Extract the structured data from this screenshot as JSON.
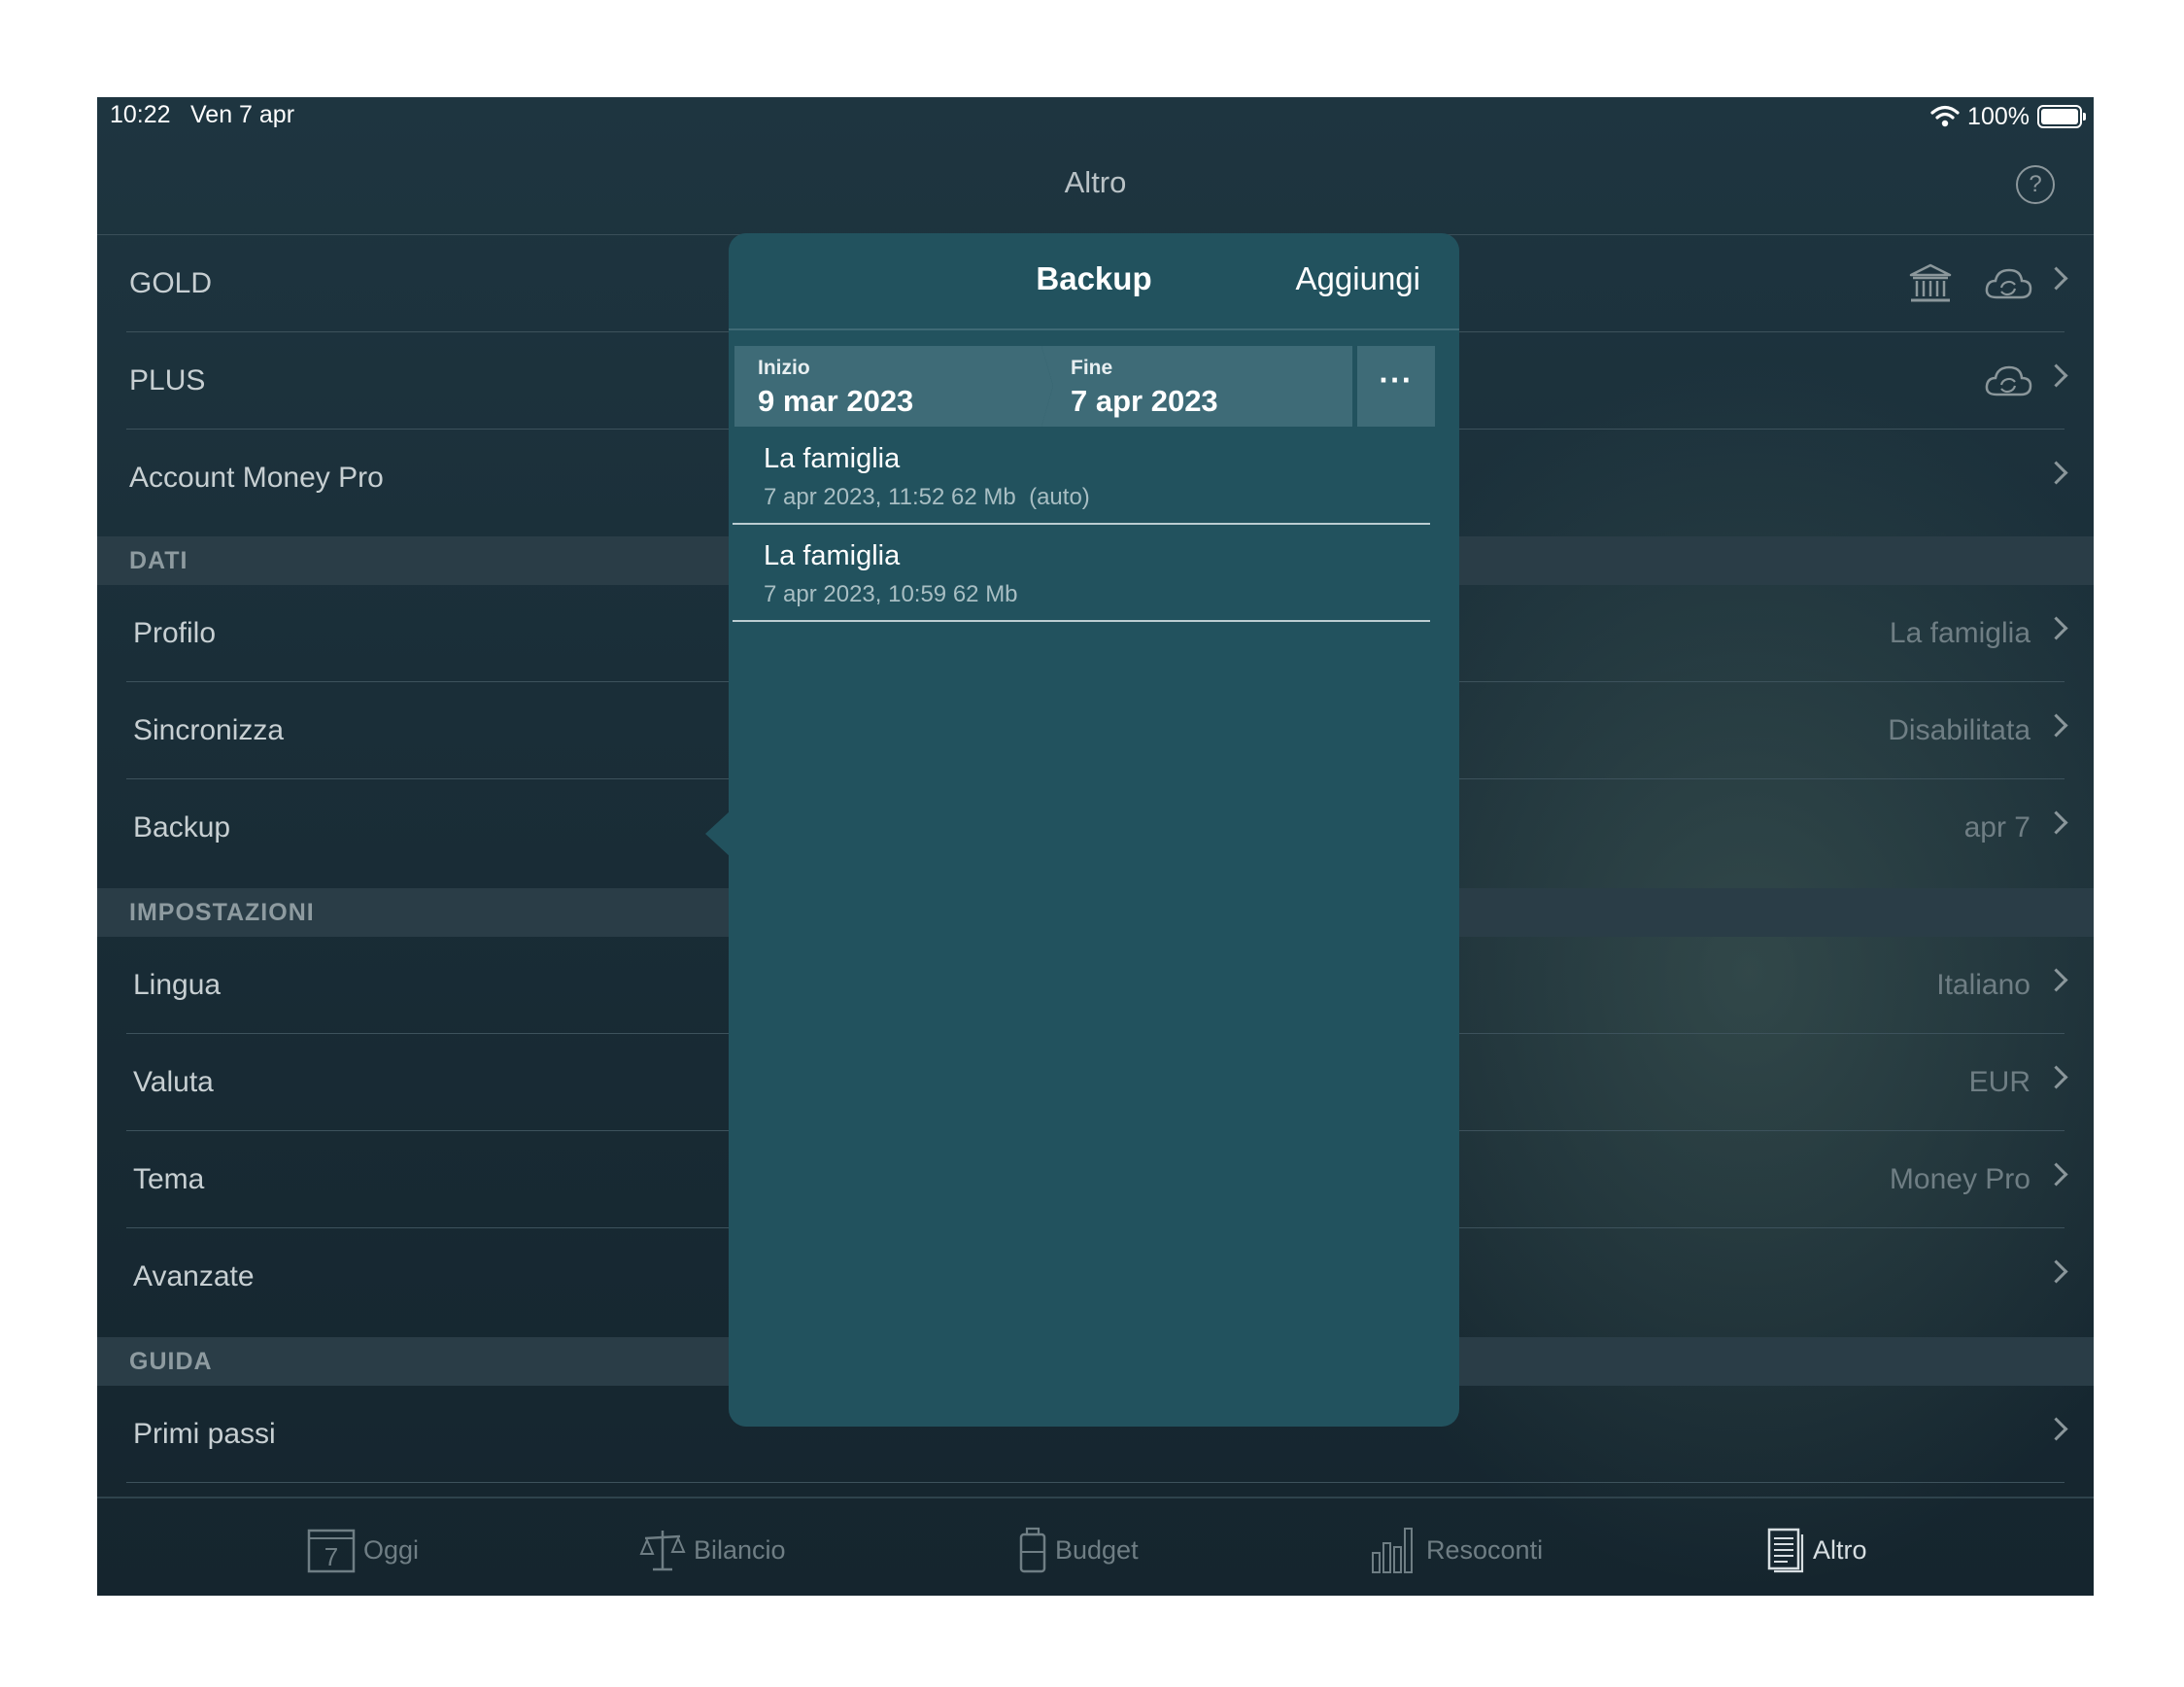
{
  "status_bar": {
    "time": "10:22",
    "date": "Ven 7 apr",
    "battery": "100%"
  },
  "nav": {
    "title": "Altro",
    "help": "?"
  },
  "rows": {
    "gold": "GOLD",
    "plus": "PLUS",
    "account": "Account Money Pro",
    "profilo": {
      "label": "Profilo",
      "value": "La famiglia"
    },
    "sincronizza": {
      "label": "Sincronizza",
      "value": "Disabilitata"
    },
    "backup": {
      "label": "Backup",
      "value": "apr 7"
    },
    "lingua": {
      "label": "Lingua",
      "value": "Italiano"
    },
    "valuta": {
      "label": "Valuta",
      "value": "EUR"
    },
    "tema": {
      "label": "Tema",
      "value": "Money Pro"
    },
    "avanzate": {
      "label": "Avanzate"
    },
    "primi_passi": {
      "label": "Primi passi"
    }
  },
  "sections": {
    "dati": "DATI",
    "impostazioni": "IMPOSTAZIONI",
    "guida": "GUIDA"
  },
  "popover": {
    "title": "Backup",
    "add": "Aggiungi",
    "start_label": "Inizio",
    "start_date": "9 mar 2023",
    "end_label": "Fine",
    "end_date": "7 apr 2023",
    "more": "···",
    "backups": [
      {
        "name": "La famiglia",
        "meta": "7 apr 2023, 11:52 62 Mb  (auto)"
      },
      {
        "name": "La famiglia",
        "meta": "7 apr 2023, 10:59 62 Mb"
      }
    ]
  },
  "tabs": {
    "oggi": "Oggi",
    "oggi_day": "7",
    "bilancio": "Bilancio",
    "budget": "Budget",
    "resoconti": "Resoconti",
    "altro": "Altro"
  }
}
